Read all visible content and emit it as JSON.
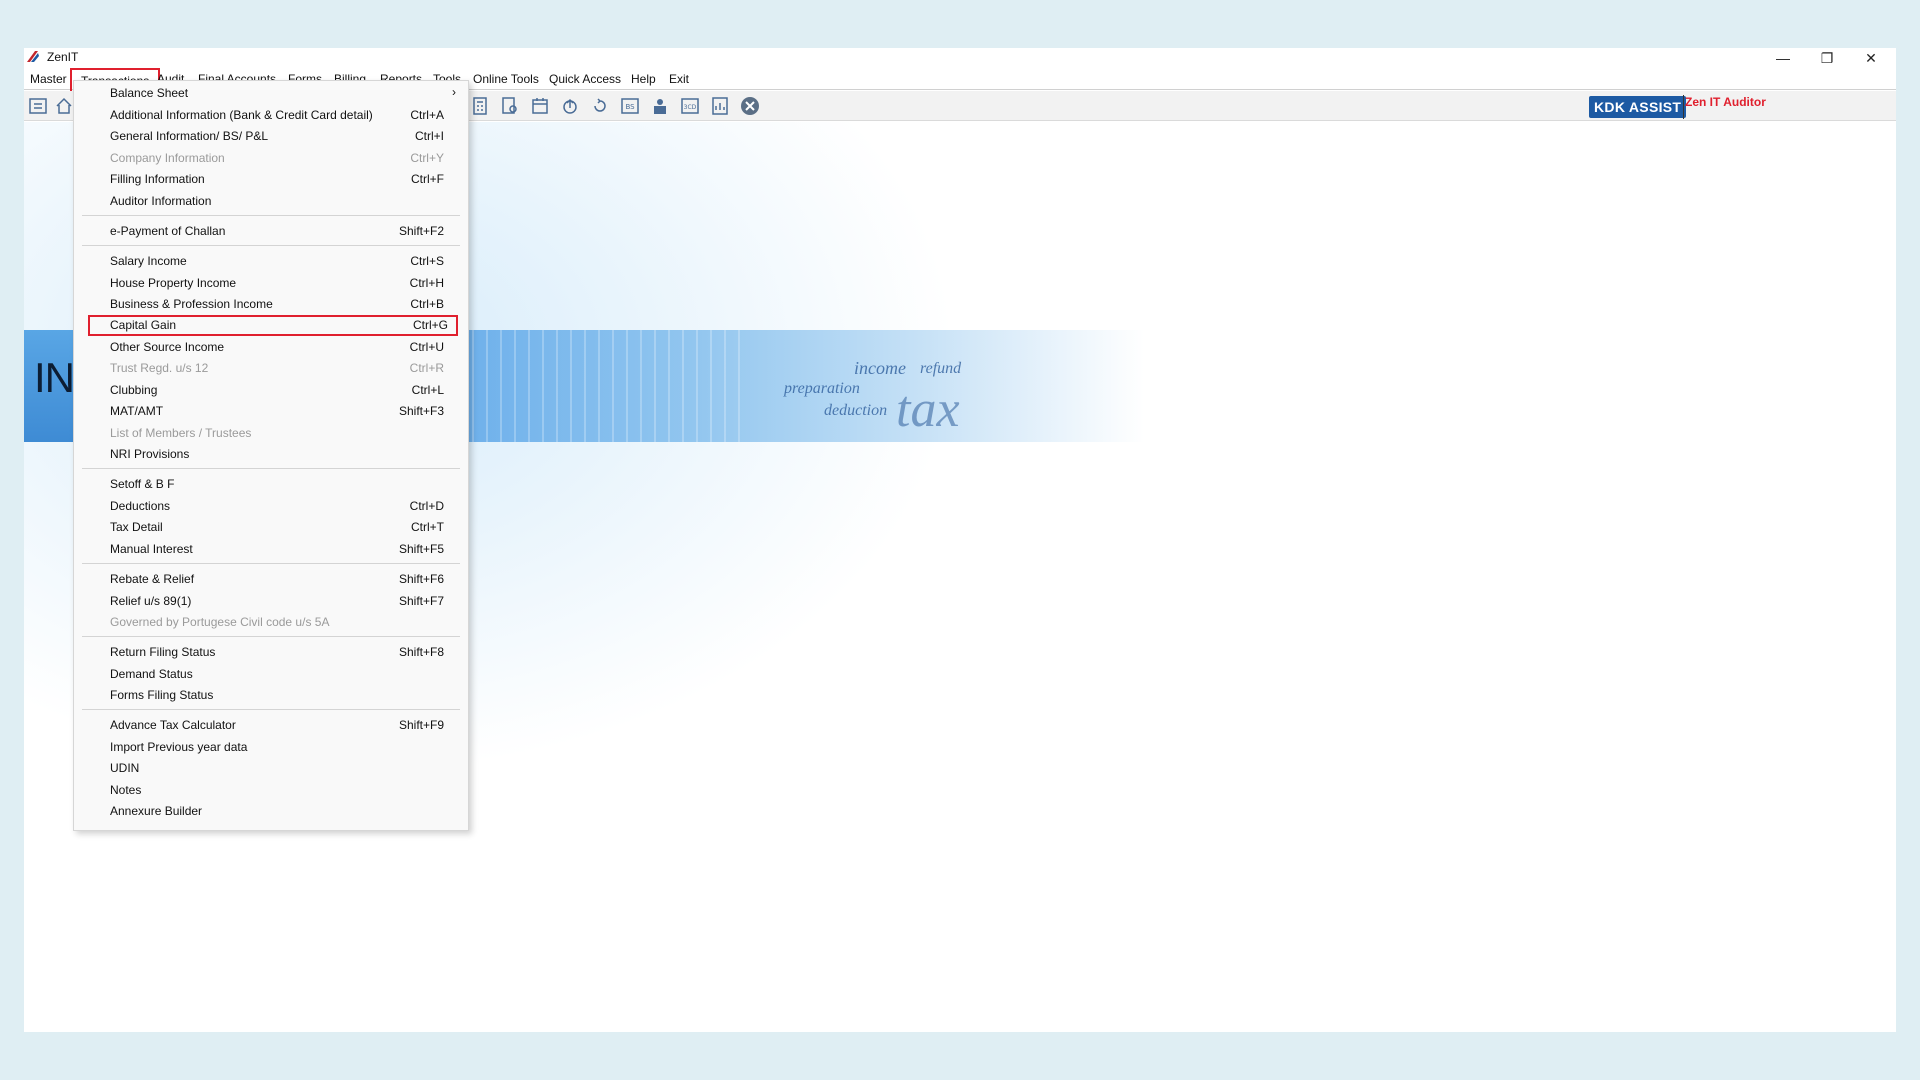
{
  "app": {
    "title": "ZenIT"
  },
  "window_controls": {
    "minimize": "—",
    "restore": "❐",
    "close": "✕"
  },
  "menubar": [
    {
      "label": "Master"
    },
    {
      "label": "Transactions"
    },
    {
      "label": "Audit"
    },
    {
      "label": "Final Accounts"
    },
    {
      "label": "Forms"
    },
    {
      "label": "Billing"
    },
    {
      "label": "Reports"
    },
    {
      "label": "Tools"
    },
    {
      "label": "Online Tools"
    },
    {
      "label": "Quick Access"
    },
    {
      "label": "Help"
    },
    {
      "label": "Exit"
    }
  ],
  "toolbar": {
    "kdk_assist": "KDK ASSIST",
    "zen_auditor": "Zen IT Auditor"
  },
  "banner": {
    "text": "INC",
    "words": [
      "income",
      "refund",
      "preparation",
      "deduction",
      "tax"
    ]
  },
  "transactions_menu": {
    "items": [
      {
        "label": "Balance Sheet",
        "shortcut": "",
        "submenu": true
      },
      {
        "label": "Additional Information (Bank & Credit Card detail)",
        "shortcut": "Ctrl+A"
      },
      {
        "label": "General Information/ BS/ P&L",
        "shortcut": "Ctrl+I"
      },
      {
        "label": "Company Information",
        "shortcut": "Ctrl+Y",
        "disabled": true
      },
      {
        "label": "Filling Information",
        "shortcut": "Ctrl+F"
      },
      {
        "label": "Auditor Information",
        "shortcut": ""
      },
      {
        "label": "e-Payment of Challan",
        "shortcut": "Shift+F2"
      },
      {
        "label": "Salary Income",
        "shortcut": "Ctrl+S"
      },
      {
        "label": "House Property Income",
        "shortcut": "Ctrl+H"
      },
      {
        "label": "Business & Profession Income",
        "shortcut": "Ctrl+B"
      },
      {
        "label": "Capital Gain",
        "shortcut": "Ctrl+G",
        "highlighted": true
      },
      {
        "label": "Other Source Income",
        "shortcut": "Ctrl+U"
      },
      {
        "label": "Trust Regd. u/s 12",
        "shortcut": "Ctrl+R",
        "disabled": true
      },
      {
        "label": "Clubbing",
        "shortcut": "Ctrl+L"
      },
      {
        "label": "MAT/AMT",
        "shortcut": "Shift+F3"
      },
      {
        "label": "List of Members / Trustees",
        "shortcut": "",
        "disabled": true
      },
      {
        "label": "NRI Provisions",
        "shortcut": ""
      },
      {
        "label": "Setoff & B F",
        "shortcut": ""
      },
      {
        "label": "Deductions",
        "shortcut": "Ctrl+D"
      },
      {
        "label": "Tax Detail",
        "shortcut": "Ctrl+T"
      },
      {
        "label": "Manual Interest",
        "shortcut": "Shift+F5"
      },
      {
        "label": "Rebate & Relief",
        "shortcut": "Shift+F6"
      },
      {
        "label": "Relief u/s 89(1)",
        "shortcut": "Shift+F7"
      },
      {
        "label": "Governed by Portugese Civil code u/s 5A",
        "shortcut": "",
        "disabled": true
      },
      {
        "label": "Return Filing Status",
        "shortcut": "Shift+F8"
      },
      {
        "label": "Demand Status",
        "shortcut": ""
      },
      {
        "label": "Forms Filing Status",
        "shortcut": ""
      },
      {
        "label": "Advance Tax Calculator",
        "shortcut": "Shift+F9"
      },
      {
        "label": "Import Previous year data",
        "shortcut": ""
      },
      {
        "label": "UDIN",
        "shortcut": ""
      },
      {
        "label": "Notes",
        "shortcut": ""
      },
      {
        "label": "Annexure Builder",
        "shortcut": ""
      }
    ]
  },
  "colors": {
    "highlight": "#e0202e",
    "kdk_bg": "#1d5aa3",
    "auditor_text": "#e0202e"
  }
}
